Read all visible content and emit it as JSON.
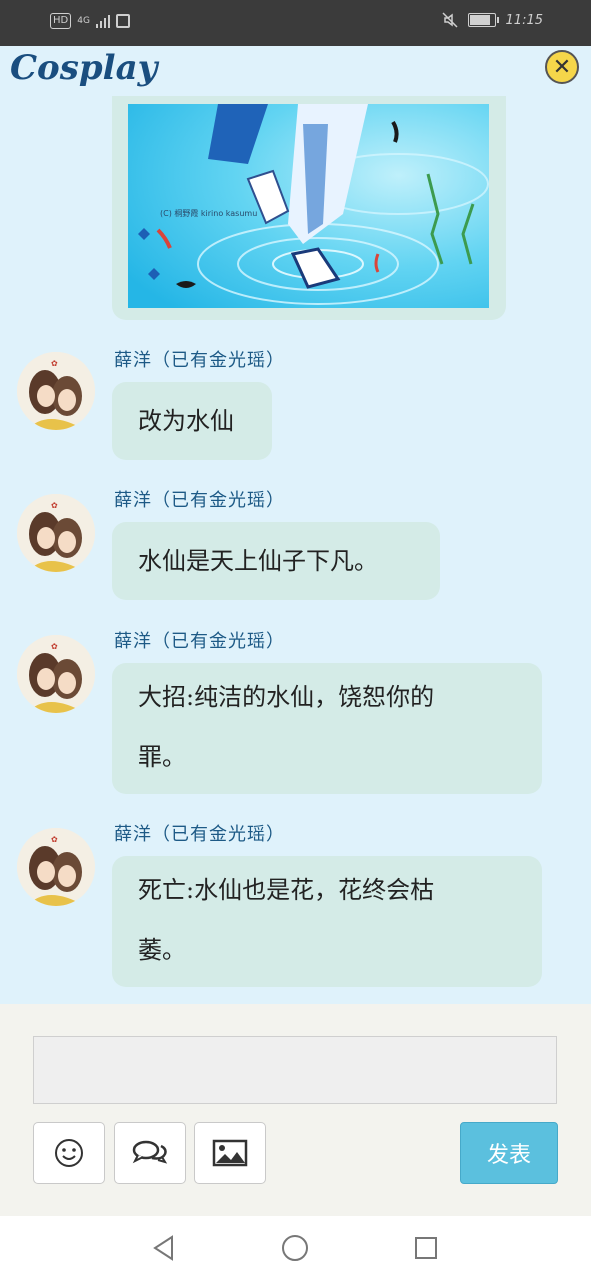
{
  "status_bar": {
    "network_hd": "HD",
    "network_type": "4G",
    "time": "11:15"
  },
  "header": {
    "title": "Cosplay",
    "close_icon": "close-icon"
  },
  "image_message": {
    "credit": "(C) 桐野霞 kirino kasumu"
  },
  "messages": [
    {
      "sender": "薛洋（已有金光瑶）",
      "lines": [
        "改为水仙"
      ]
    },
    {
      "sender": "薛洋（已有金光瑶）",
      "lines": [
        "水仙是天上仙子下凡。"
      ]
    },
    {
      "sender": "薛洋（已有金光瑶）",
      "lines": [
        "大招:纯洁的水仙，饶恕你的",
        "罪。"
      ]
    },
    {
      "sender": "薛洋（已有金光瑶）",
      "lines": [
        "死亡:水仙也是花，花终会枯",
        "萎。"
      ]
    }
  ],
  "composer": {
    "input_value": "",
    "input_placeholder": "",
    "emoji_icon": "smiley-icon",
    "chat_icon": "speech-bubbles-icon",
    "image_icon": "image-icon",
    "send_label": "发表"
  },
  "navbar": {
    "back_icon": "back-triangle-icon",
    "home_icon": "home-circle-icon",
    "recents_icon": "recents-square-icon"
  },
  "colors": {
    "page_bg": "#dff2fb",
    "bubble_bg": "#d4ebe7",
    "sender_text": "#1d5a86",
    "send_button": "#5bc0de",
    "close_button": "#f5d64a"
  }
}
